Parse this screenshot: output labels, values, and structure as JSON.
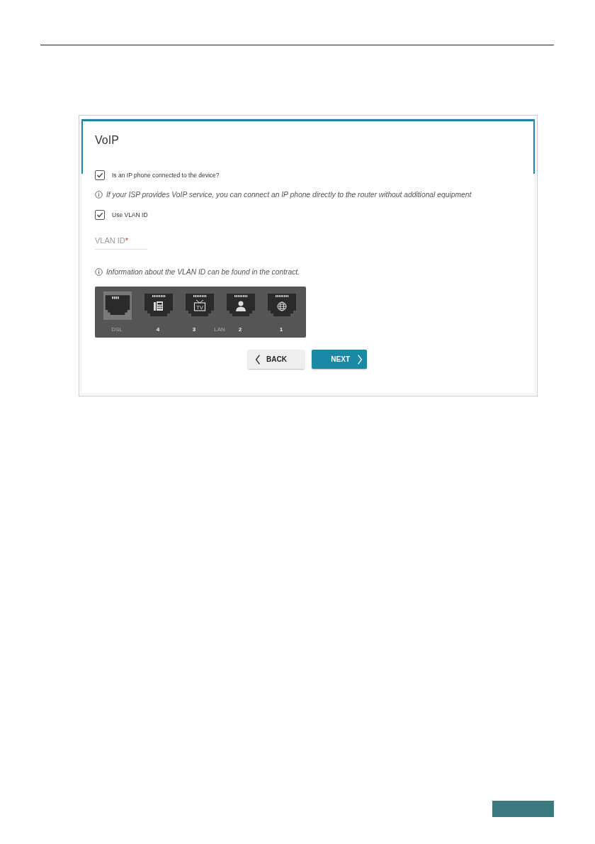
{
  "title": "VoIP",
  "options": [
    {
      "label": "Is an IP phone connected to the device?",
      "checked": true,
      "note": "If your ISP provides VoIP service, you can connect an IP phone directly to the router without additional equipment"
    },
    {
      "label": "Use VLAN ID",
      "checked": true
    }
  ],
  "vlan_field": {
    "label": "VLAN ID",
    "required_mark": "*"
  },
  "vlan_note": "Information about the VLAN ID can be found in the contract.",
  "ports": [
    {
      "kind": "plain",
      "label": "DSL",
      "selected": true
    },
    {
      "kind": "phone",
      "label": "4",
      "selected": false
    },
    {
      "kind": "tv",
      "label": "3",
      "icon_text": "TV",
      "selected": false
    },
    {
      "kind": "group",
      "label": "LAN"
    },
    {
      "kind": "user",
      "label": "2",
      "selected": false
    },
    {
      "kind": "globe",
      "label": "1",
      "selected": false
    }
  ],
  "buttons": [
    {
      "kind": "back",
      "label": "BACK"
    },
    {
      "kind": "next",
      "label": "NEXT"
    }
  ]
}
